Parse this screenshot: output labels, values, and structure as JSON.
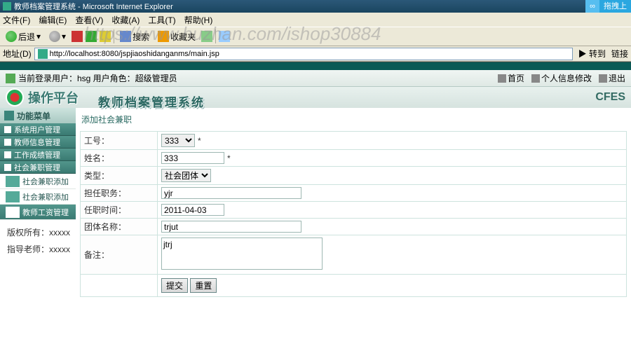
{
  "window": {
    "title": "教师档案管理系统 - Microsoft Internet Explorer"
  },
  "float": {
    "icon": "∞",
    "text": "拖拽上"
  },
  "menubar": [
    "文件(F)",
    "编辑(E)",
    "查看(V)",
    "收藏(A)",
    "工具(T)",
    "帮助(H)"
  ],
  "toolbar": {
    "back": "后退",
    "search": "搜索",
    "fav": "收藏夹"
  },
  "watermark": "https://www.huzhan.com/ishop30884",
  "address": {
    "label": "地址(D)",
    "url": "http://localhost:8080/jspjiaoshidanganms/main.jsp",
    "go": "转到",
    "links": "链接"
  },
  "header": {
    "loginInfo": "当前登录用户：hsg   用户角色：超级管理员",
    "links": {
      "home": "首页",
      "profile": "个人信息修改",
      "logout": "退出"
    }
  },
  "brand": {
    "platform": "操作平台",
    "sysname": "教师档案管理系统",
    "badge": "CFES"
  },
  "sidebar": {
    "head": "功能菜单",
    "groups": [
      {
        "label": "系统用户管理"
      },
      {
        "label": "教师信息管理"
      },
      {
        "label": "工作成绩管理"
      },
      {
        "label": "社会兼职管理",
        "items": [
          {
            "label": "社会兼职添加",
            "active": false
          },
          {
            "label": "社会兼职添加",
            "active": false
          }
        ]
      },
      {
        "label": "教师工资管理",
        "active": true
      }
    ],
    "footer": {
      "copyright": "版权所有：xxxxx",
      "advisor": "指导老师：xxxxx"
    }
  },
  "form": {
    "title": "添加社会兼职",
    "fields": {
      "gonghao": {
        "label": "工号：",
        "value": "333"
      },
      "xingming": {
        "label": "姓名：",
        "value": "333"
      },
      "leixing": {
        "label": "类型：",
        "value": "社会团体"
      },
      "zhiwu": {
        "label": "担任职务：",
        "value": "yjr"
      },
      "shijian": {
        "label": "任职时间：",
        "value": "2011-04-03"
      },
      "tuanti": {
        "label": "团体名称：",
        "value": "trjut"
      },
      "beizhu": {
        "label": "备注：",
        "value": "jtrj"
      }
    },
    "buttons": {
      "submit": "提交",
      "reset": "重置"
    }
  }
}
